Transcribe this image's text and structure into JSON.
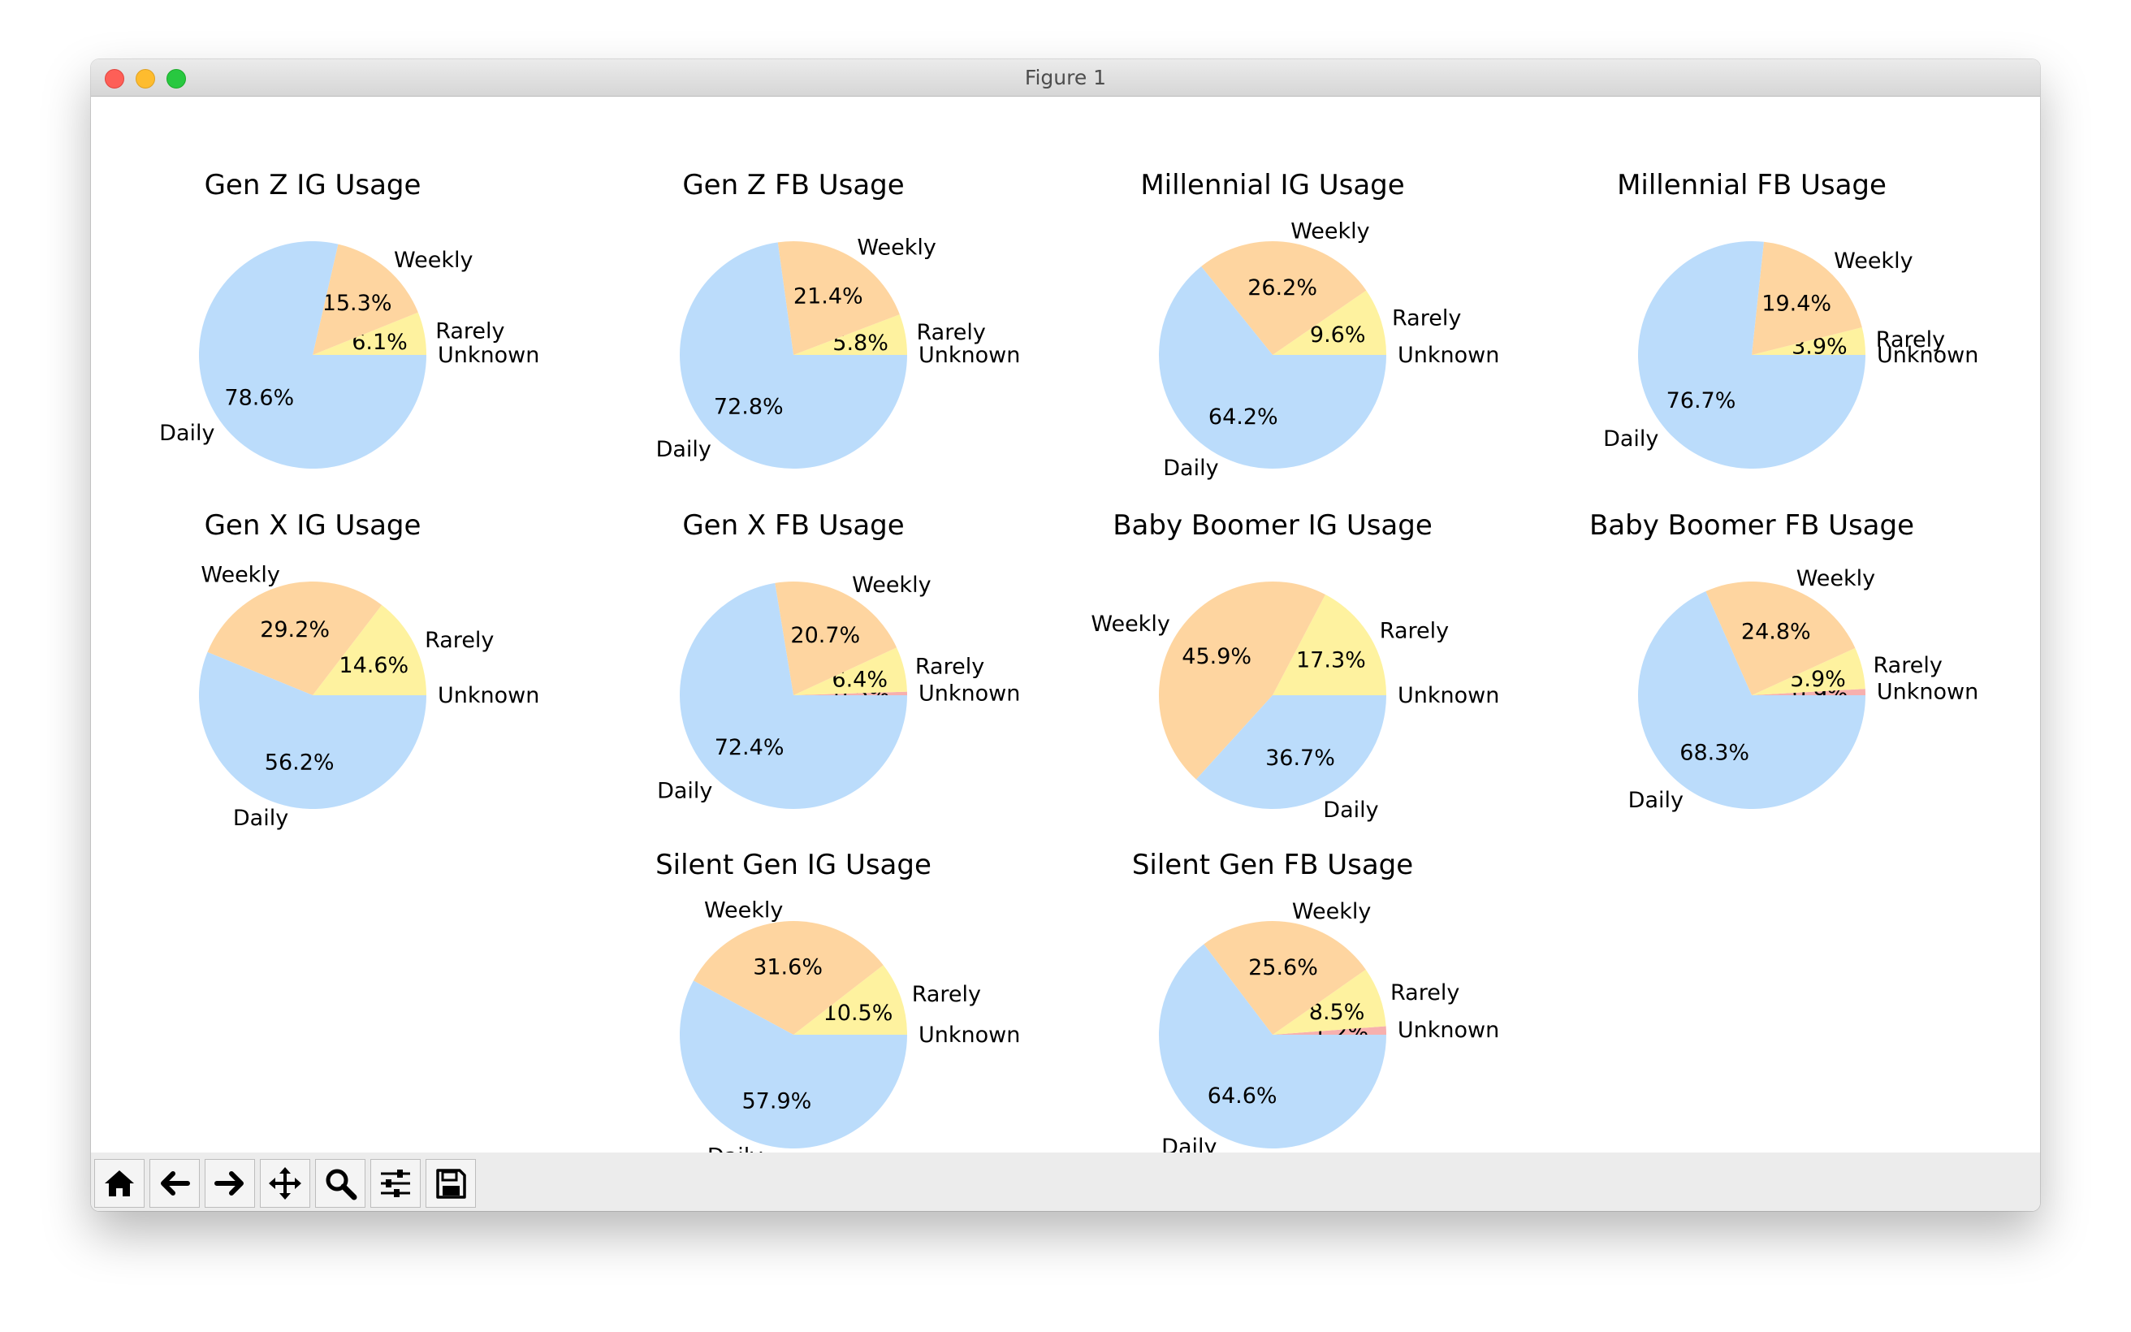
{
  "window": {
    "title": "Figure 1"
  },
  "toolbar": {
    "buttons": [
      {
        "name": "home-icon"
      },
      {
        "name": "back-arrow-icon"
      },
      {
        "name": "forward-arrow-icon"
      },
      {
        "name": "pan-move-icon"
      },
      {
        "name": "zoom-magnifier-icon"
      },
      {
        "name": "configure-subplots-icon"
      },
      {
        "name": "save-disk-icon"
      }
    ]
  },
  "colors": {
    "Daily": "#bbdcfb",
    "Weekly": "#fed5a0",
    "Rarely": "#fef29f",
    "Unknown": "#f7b0ae"
  },
  "chart_data": [
    {
      "type": "pie",
      "title": "Gen Z IG Usage",
      "labels": [
        "Unknown",
        "Rarely",
        "Weekly",
        "Daily"
      ],
      "values": [
        0.0,
        6.1,
        15.3,
        78.6
      ]
    },
    {
      "type": "pie",
      "title": "Gen Z FB Usage",
      "labels": [
        "Unknown",
        "Rarely",
        "Weekly",
        "Daily"
      ],
      "values": [
        0.0,
        5.8,
        21.4,
        72.8
      ]
    },
    {
      "type": "pie",
      "title": "Millennial IG Usage",
      "labels": [
        "Unknown",
        "Rarely",
        "Weekly",
        "Daily"
      ],
      "values": [
        0.0,
        9.6,
        26.2,
        64.2
      ]
    },
    {
      "type": "pie",
      "title": "Millennial FB Usage",
      "labels": [
        "Unknown",
        "Rarely",
        "Weekly",
        "Daily"
      ],
      "values": [
        0.0,
        3.9,
        19.4,
        76.7
      ]
    },
    {
      "type": "pie",
      "title": "Gen X IG Usage",
      "labels": [
        "Unknown",
        "Rarely",
        "Weekly",
        "Daily"
      ],
      "values": [
        0.0,
        14.6,
        29.2,
        56.2
      ]
    },
    {
      "type": "pie",
      "title": "Gen X FB Usage",
      "labels": [
        "Unknown",
        "Rarely",
        "Weekly",
        "Daily"
      ],
      "values": [
        0.5,
        6.4,
        20.7,
        72.4
      ]
    },
    {
      "type": "pie",
      "title": "Baby Boomer IG Usage",
      "labels": [
        "Unknown",
        "Rarely",
        "Weekly",
        "Daily"
      ],
      "values": [
        0.0,
        17.3,
        45.9,
        36.7
      ]
    },
    {
      "type": "pie",
      "title": "Baby Boomer FB Usage",
      "labels": [
        "Unknown",
        "Rarely",
        "Weekly",
        "Daily"
      ],
      "values": [
        0.9,
        5.9,
        24.8,
        68.3
      ]
    },
    {
      "type": "pie",
      "title": "Silent Gen IG Usage",
      "labels": [
        "Unknown",
        "Rarely",
        "Weekly",
        "Daily"
      ],
      "values": [
        0.0,
        10.5,
        31.6,
        57.9
      ]
    },
    {
      "type": "pie",
      "title": "Silent Gen FB Usage",
      "labels": [
        "Unknown",
        "Rarely",
        "Weekly",
        "Daily"
      ],
      "values": [
        1.2,
        8.5,
        25.6,
        64.6
      ]
    }
  ]
}
